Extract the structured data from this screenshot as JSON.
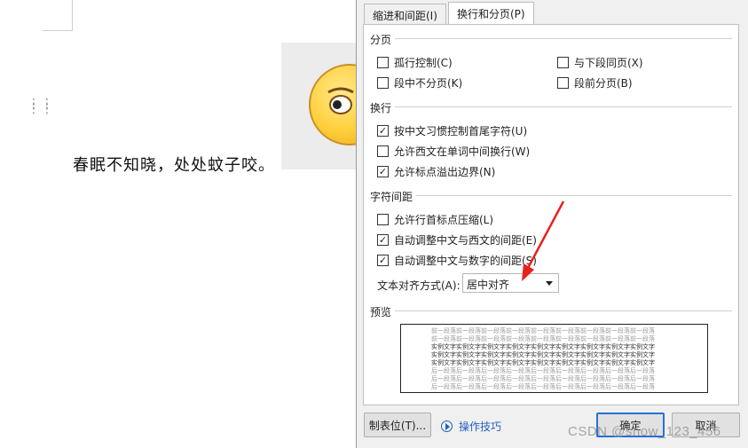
{
  "document": {
    "poem_line": "春眠不知晓，处处蚊子咬。"
  },
  "dialog": {
    "tabs": [
      {
        "label": "缩进和间距(I)",
        "active": false
      },
      {
        "label": "换行和分页(P)",
        "active": true
      }
    ],
    "sections": {
      "pagination": {
        "title": "分页",
        "options": [
          {
            "label": "孤行控制(C)",
            "checked": false
          },
          {
            "label": "与下段同页(X)",
            "checked": false
          },
          {
            "label": "段中不分页(K)",
            "checked": false
          },
          {
            "label": "段前分页(B)",
            "checked": false
          }
        ]
      },
      "line_break": {
        "title": "换行",
        "options": [
          {
            "label": "按中文习惯控制首尾字符(U)",
            "checked": true
          },
          {
            "label": "允许西文在单词中间换行(W)",
            "checked": false
          },
          {
            "label": "允许标点溢出边界(N)",
            "checked": true
          }
        ]
      },
      "char_spacing": {
        "title": "字符间距",
        "options": [
          {
            "label": "允许行首标点压缩(L)",
            "checked": false
          },
          {
            "label": "自动调整中文与西文的间距(E)",
            "checked": true
          },
          {
            "label": "自动调整中文与数字的间距(S)",
            "checked": true
          }
        ],
        "text_align_label": "文本对齐方式(A):",
        "text_align_value": "居中对齐"
      },
      "preview": {
        "title": "预览",
        "prev_line": "前一段落前一段落前一段落前一段落前一段落前一段落前一段落前一段落前一段落",
        "sample_line": "实例文字实例文字实例文字实例文字实例文字实例文字实例文字实例文字实例文字",
        "next_line": "后一段落后一段落后一段落后一段落后一段落后一段落后一段落后一段落后一段落"
      }
    },
    "buttons": {
      "tabs_label": "制表位(T)...",
      "tips_label": "操作技巧",
      "ok_label": "确定",
      "cancel_label": "取消"
    },
    "annotation_arrow_color": "#e8211b"
  },
  "watermark": "CSDN @show_123_456"
}
